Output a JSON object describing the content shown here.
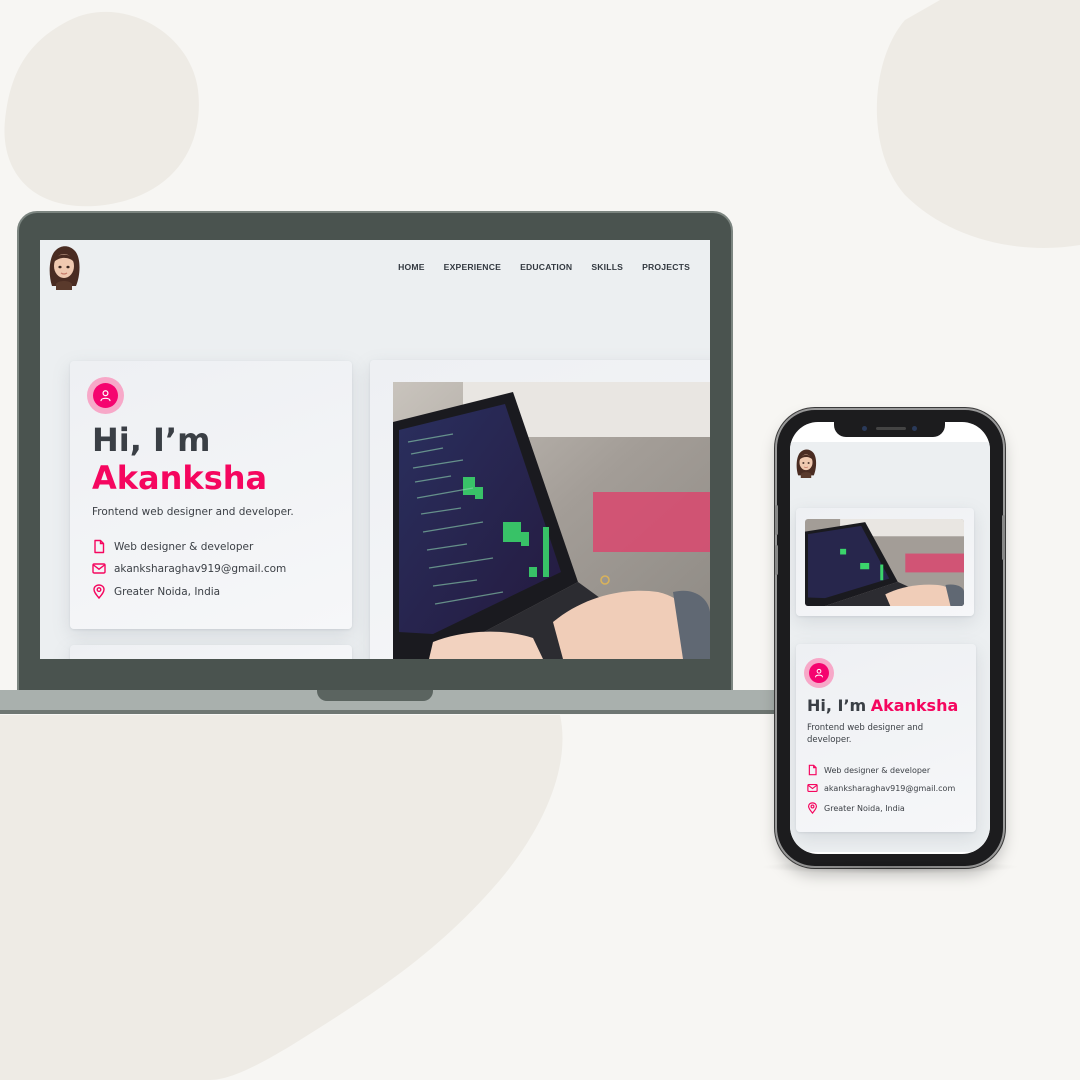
{
  "colors": {
    "accent": "#f5065f",
    "accent_light": "#f7a8c8",
    "text_dark": "#3a3f45",
    "laptop_frame": "#4a534f",
    "background": "#f7f6f3",
    "blob": "#eeebe5"
  },
  "site": {
    "nav": [
      "HOME",
      "EXPERIENCE",
      "EDUCATION",
      "SKILLS",
      "PROJECTS"
    ],
    "greeting": "Hi, I’m",
    "name": "Akanksha",
    "tagline": "Frontend web designer and developer.",
    "info": [
      {
        "icon": "document-icon",
        "text": "Web designer & developer"
      },
      {
        "icon": "mail-icon",
        "text": "akanksharaghav919@gmail.com"
      },
      {
        "icon": "location-pin-icon",
        "text": "Greater Noida, India"
      }
    ],
    "hero_badge_icon": "user-icon",
    "avatar_icon": "avatar",
    "hero_image_icon": "laptop-code-image"
  }
}
